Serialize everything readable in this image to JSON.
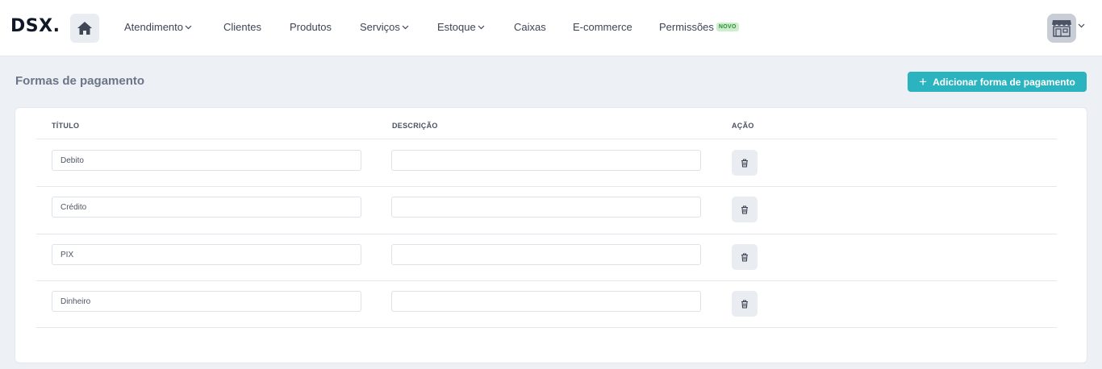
{
  "header": {
    "logo": "DSX.",
    "nav": [
      {
        "label": "Atendimento",
        "dropdown": true
      },
      {
        "label": "Clientes",
        "dropdown": false
      },
      {
        "label": "Produtos",
        "dropdown": false
      },
      {
        "label": "Serviços",
        "dropdown": true
      },
      {
        "label": "Estoque",
        "dropdown": true
      },
      {
        "label": "Caixas",
        "dropdown": false
      },
      {
        "label": "E-commerce",
        "dropdown": false
      },
      {
        "label": "Permissões",
        "dropdown": false,
        "badge": "NOVO"
      }
    ],
    "icons": {
      "home": "home-icon",
      "store": "store-icon"
    }
  },
  "page": {
    "title": "Formas de pagamento",
    "add_button": "Adicionar forma de pagamento",
    "accent_color": "#2bb3c0"
  },
  "table": {
    "columns": [
      "TÍTULO",
      "DESCRIÇÃO",
      "AÇÃO"
    ],
    "rows": [
      {
        "titulo": "Debito",
        "descricao": ""
      },
      {
        "titulo": "Crédito",
        "descricao": ""
      },
      {
        "titulo": "PIX",
        "descricao": ""
      },
      {
        "titulo": "Dinheiro",
        "descricao": ""
      }
    ],
    "action_icon": "trash-icon"
  }
}
